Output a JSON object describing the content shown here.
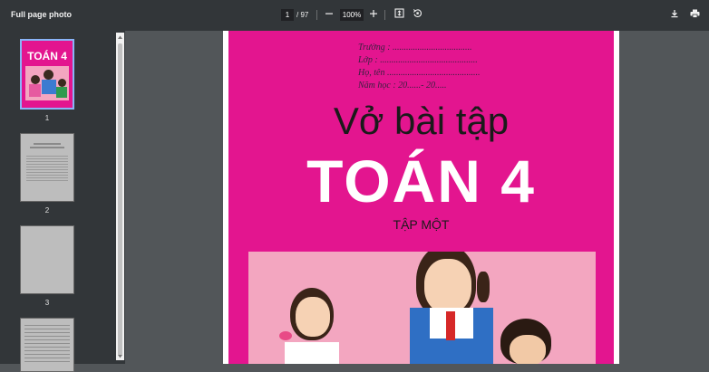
{
  "toolbar": {
    "title": "Full page photo",
    "current_page": "1",
    "total_pages": "/ 97",
    "zoom": "100%",
    "zoom_out_icon": "minus-icon",
    "zoom_in_icon": "plus-icon",
    "fit_icon": "fit-page-icon",
    "rotate_icon": "rotate-icon",
    "download_icon": "download-icon",
    "print_icon": "print-icon"
  },
  "sidebar": {
    "thumbnails": [
      {
        "label": "1",
        "selected": true
      },
      {
        "label": "2",
        "selected": false
      },
      {
        "label": "3",
        "selected": false
      }
    ],
    "thumb1_title": "TOÁN 4"
  },
  "document": {
    "line_school": "Trường : ...................................",
    "line_class": "Lớp : ...........................................",
    "line_name": "Họ, tên .........................................",
    "line_year": "Năm học : 20......- 20.....",
    "title": "Vở bài tập",
    "subject": "TOÁN 4",
    "volume": "TẬP MỘT",
    "cover_color": "#e3158f"
  }
}
